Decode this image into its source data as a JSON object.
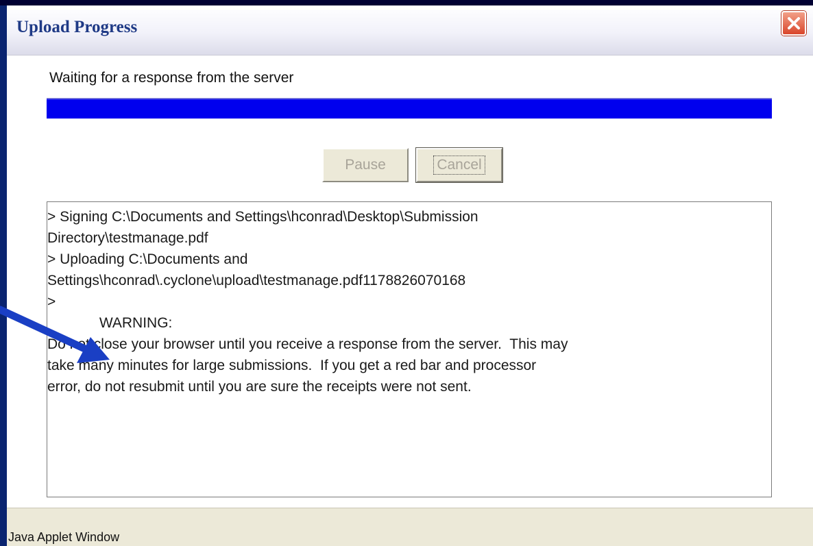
{
  "window": {
    "title": "Upload Progress",
    "close_icon": "close-x-icon"
  },
  "progress": {
    "status": "Waiting for a response from the server",
    "fraction": 1.0,
    "color": "#0000EE"
  },
  "buttons": {
    "pause": "Pause",
    "cancel": "Cancel"
  },
  "log": {
    "lines": [
      "> Signing C:\\Documents and Settings\\hconrad\\Desktop\\Submission",
      "Directory\\testmanage.pdf",
      "> Uploading C:\\Documents and",
      "Settings\\hconrad\\.cyclone\\upload\\testmanage.pdf1178826070168",
      ">",
      "             WARNING:",
      "Do not close your browser until you receive a response from the server.  This may",
      "take many minutes for large submissions.  If you get a red bar and processor",
      "error, do not resubmit until you are sure the receipts were not sent."
    ]
  },
  "footer": {
    "text": "Java Applet Window"
  },
  "annotation": {
    "arrow_icon": "blue-arrow-icon",
    "arrow_color": "#1a3fc4"
  }
}
